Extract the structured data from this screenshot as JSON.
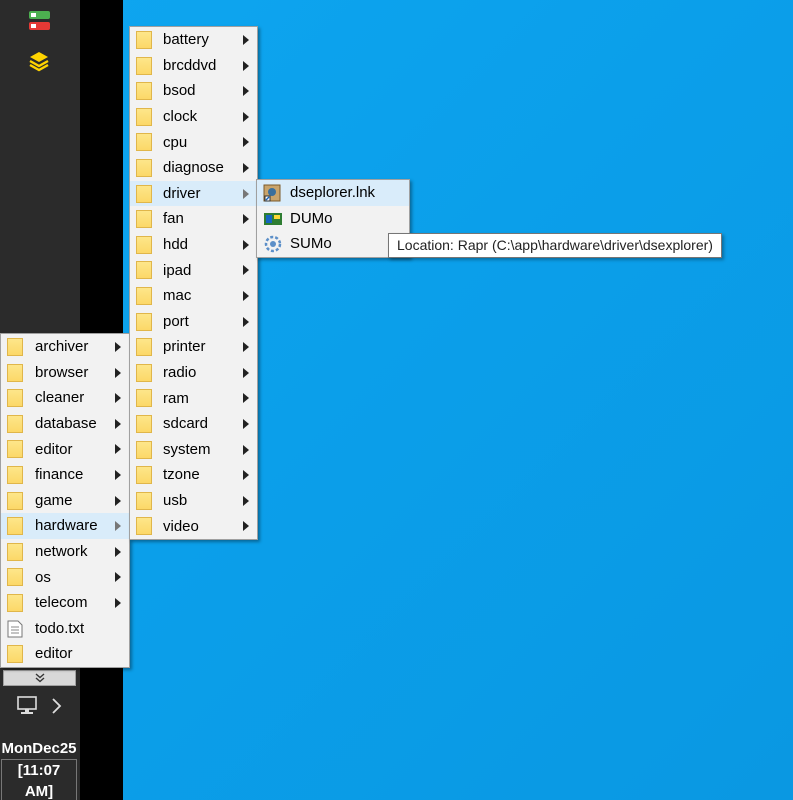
{
  "clock": {
    "date": "MonDec25",
    "time": "[11:07 AM]"
  },
  "main_menu": {
    "items": [
      {
        "label": "archiver",
        "icon": "folder-icon",
        "submenu": true
      },
      {
        "label": "browser",
        "icon": "folder-icon",
        "submenu": true
      },
      {
        "label": "cleaner",
        "icon": "folder-icon",
        "submenu": true
      },
      {
        "label": "database",
        "icon": "folder-icon",
        "submenu": true
      },
      {
        "label": "editor",
        "icon": "folder-icon",
        "submenu": true
      },
      {
        "label": "finance",
        "icon": "folder-icon",
        "submenu": true
      },
      {
        "label": "game",
        "icon": "folder-icon",
        "submenu": true
      },
      {
        "label": "hardware",
        "icon": "folder-icon",
        "submenu": true,
        "active": true
      },
      {
        "label": "network",
        "icon": "folder-icon",
        "submenu": true
      },
      {
        "label": "os",
        "icon": "folder-icon",
        "submenu": true
      },
      {
        "label": "telecom",
        "icon": "folder-icon",
        "submenu": true
      },
      {
        "label": "todo.txt",
        "icon": "text-file-icon",
        "submenu": false
      },
      {
        "label": "editor",
        "icon": "folder-icon",
        "submenu": false
      }
    ]
  },
  "hardware_menu": {
    "items": [
      {
        "label": "battery"
      },
      {
        "label": "brcddvd"
      },
      {
        "label": "bsod"
      },
      {
        "label": "clock"
      },
      {
        "label": "cpu"
      },
      {
        "label": "diagnose"
      },
      {
        "label": "driver",
        "active": true
      },
      {
        "label": "fan"
      },
      {
        "label": "hdd"
      },
      {
        "label": "ipad"
      },
      {
        "label": "mac"
      },
      {
        "label": "port"
      },
      {
        "label": "printer"
      },
      {
        "label": "radio"
      },
      {
        "label": "ram"
      },
      {
        "label": "sdcard"
      },
      {
        "label": "system"
      },
      {
        "label": "tzone"
      },
      {
        "label": "usb"
      },
      {
        "label": "video"
      }
    ]
  },
  "driver_menu": {
    "items": [
      {
        "label": "dseplorer.lnk",
        "icon": "shortcut-app-icon",
        "active": true
      },
      {
        "label": "DUMo",
        "icon": "dumo-app-icon"
      },
      {
        "label": "SUMo",
        "icon": "sumo-app-icon"
      }
    ]
  },
  "tooltip": {
    "text": "Location: Rapr (C:\\app\\hardware\\driver\\dsexplorer)"
  },
  "colors": {
    "desktop": "#0aa3ee",
    "highlight": "#d9ecfa",
    "menu_bg": "#f2f2f2",
    "taskbar": "#2b2b2b"
  }
}
